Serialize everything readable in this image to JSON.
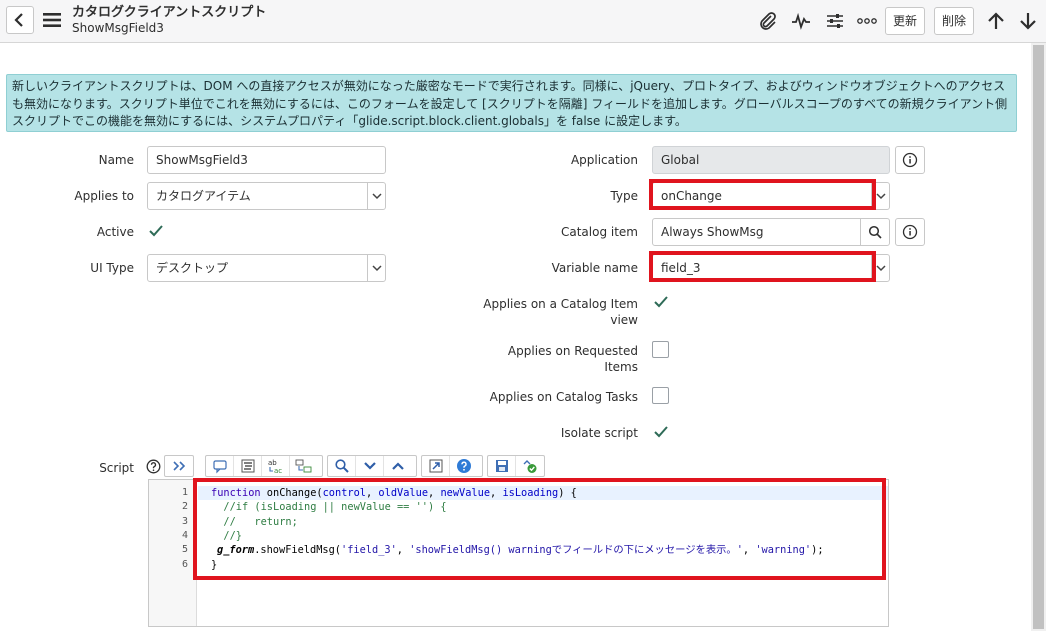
{
  "header": {
    "title": "カタログクライアントスクリプト",
    "subtitle": "ShowMsgField3",
    "update_label": "更新",
    "delete_label": "削除"
  },
  "banner": {
    "text": "新しいクライアントスクリプトは、DOM への直接アクセスが無効になった厳密なモードで実行されます。同様に、jQuery、プロトタイプ、およびウィンドウオブジェクトへのアクセスも無効になります。スクリプト単位でこれを無効にするには、このフォームを設定して [スクリプトを隔離] フィールドを追加します。グローバルスコープのすべての新規クライアント側スクリプトでこの機能を無効にするには、システムプロパティ「glide.script.block.client.globals」を false に設定します。"
  },
  "form": {
    "name_label": "Name",
    "name_value": "ShowMsgField3",
    "applies_to_label": "Applies to",
    "applies_to_value": "カタログアイテム",
    "active_label": "Active",
    "ui_type_label": "UI Type",
    "ui_type_value": "デスクトップ",
    "application_label": "Application",
    "application_value": "Global",
    "type_label": "Type",
    "type_value": "onChange",
    "catalog_item_label": "Catalog item",
    "catalog_item_value": "Always ShowMsg",
    "variable_name_label": "Variable name",
    "variable_name_value": "field_3",
    "applies_catalog_view_label_1": "Applies on a Catalog Item",
    "applies_catalog_view_label_2": "view",
    "applies_requested_label_1": "Applies on Requested",
    "applies_requested_label_2": "Items",
    "applies_tasks_label": "Applies on Catalog Tasks",
    "isolate_label": "Isolate script",
    "script_label": "Script",
    "checkboxes": {
      "active": true,
      "applies_catalog_view": true,
      "applies_requested": false,
      "applies_tasks": false,
      "isolate": true
    }
  },
  "editor": {
    "line_numbers": [
      "1",
      "2",
      "3",
      "4",
      "5",
      "6"
    ],
    "line1": {
      "kw": "function",
      "fn": " onChange(",
      "p1": "control",
      "c1": ", ",
      "p2": "oldValue",
      "c2": ", ",
      "p3": "newValue",
      "c3": ", ",
      "p4": "isLoading",
      "end": ") {"
    },
    "line2": "  //if (isLoading || newValue == '') {",
    "line3": "  //   return;",
    "line4": "  //}",
    "line5": {
      "obj": "g_form",
      "call": ".showFieldMsg(",
      "s1": "'field_3'",
      "c1": ", ",
      "s2": "'showFieldMsg() warningでフィールドの下にメッセージを表示。'",
      "c2": ", ",
      "s3": "'warning'",
      "end": ");"
    },
    "line6": "}"
  },
  "colors": {
    "highlight": "#e0141e",
    "banner_bg": "#b5e3e6",
    "checkmark": "#2e6b57"
  }
}
